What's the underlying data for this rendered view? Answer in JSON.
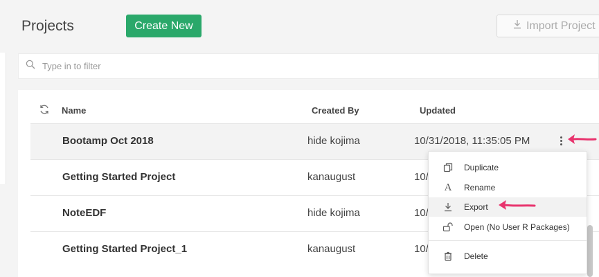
{
  "header": {
    "title": "Projects",
    "create_label": "Create New",
    "import_label": "Import Project"
  },
  "filter": {
    "placeholder": "Type in to filter"
  },
  "table": {
    "columns": [
      "Name",
      "Created By",
      "Updated"
    ],
    "rows": [
      {
        "name": "Bootamp Oct 2018",
        "created_by": "hide kojima",
        "updated": "10/31/2018, 11:35:05 PM"
      },
      {
        "name": "Getting Started Project",
        "created_by": "kanaugust",
        "updated": "10/"
      },
      {
        "name": "NoteEDF",
        "created_by": "hide kojima",
        "updated": "10/"
      },
      {
        "name": "Getting Started Project_1",
        "created_by": "kanaugust",
        "updated": "10/"
      }
    ]
  },
  "context_menu": {
    "items": [
      {
        "label": "Duplicate",
        "icon": "duplicate-icon"
      },
      {
        "label": "Rename",
        "icon": "rename-icon"
      },
      {
        "label": "Export",
        "icon": "export-icon"
      },
      {
        "label": "Open (No User R Packages)",
        "icon": "unlock-icon"
      },
      {
        "label": "Delete",
        "icon": "trash-icon"
      }
    ]
  },
  "colors": {
    "accent": "#2aa86a",
    "arrow": "#e8336d"
  }
}
